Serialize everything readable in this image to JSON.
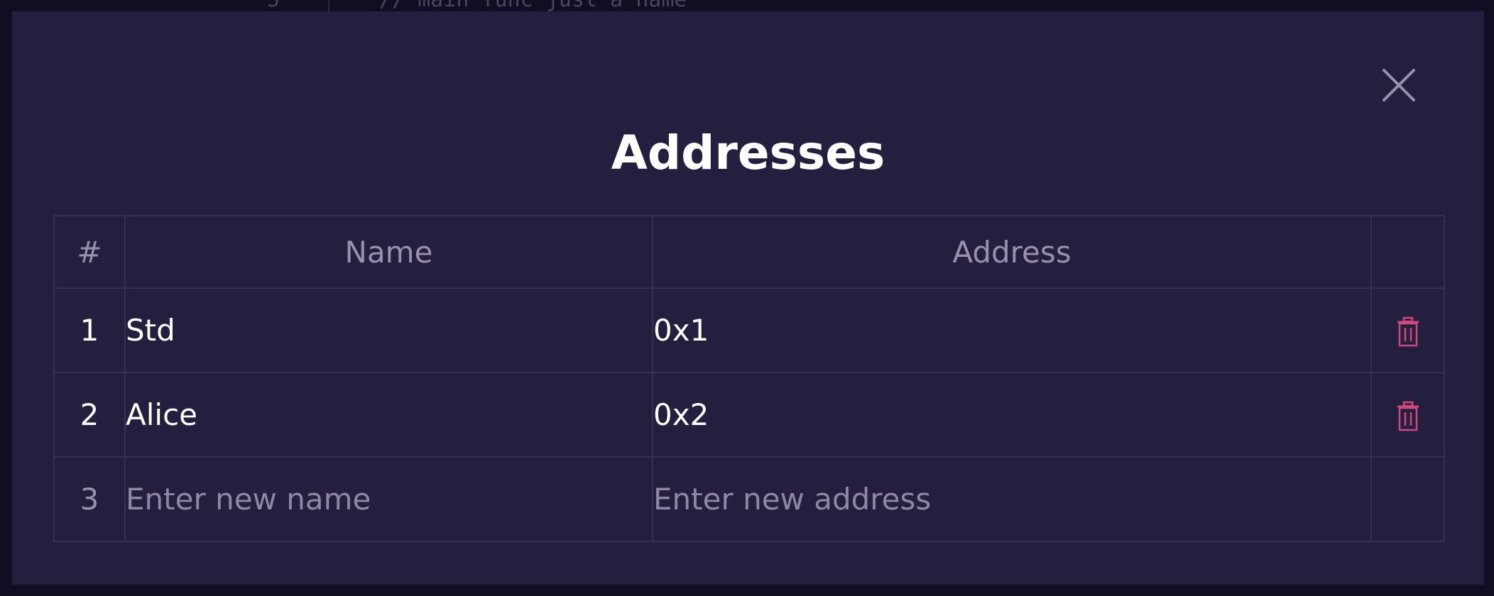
{
  "background_editor": {
    "line_number": "5",
    "code_text": "// main func just a name"
  },
  "modal": {
    "title": "Addresses",
    "close_icon": "close-icon",
    "table": {
      "headers": {
        "number": "#",
        "name": "Name",
        "address": "Address",
        "actions": ""
      },
      "rows": [
        {
          "index": "1",
          "name": "Std",
          "address": "0x1"
        },
        {
          "index": "2",
          "name": "Alice",
          "address": "0x2"
        }
      ],
      "new_row": {
        "index": "3",
        "name_placeholder": "Enter new name",
        "address_placeholder": "Enter new address"
      },
      "delete_icon": "trash-icon"
    }
  },
  "colors": {
    "page_background": "#110d23",
    "modal_background": "#251f3f",
    "border": "#37304f",
    "header_text": "#9792a9",
    "primary_text": "#ffffff",
    "delete_accent": "#d1497a",
    "close_icon": "#9792a9"
  }
}
